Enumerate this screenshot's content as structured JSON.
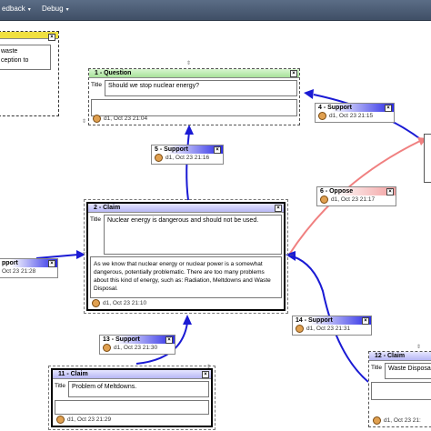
{
  "menu": {
    "feedback": "edback",
    "debug": "Debug"
  },
  "partial_top_left": {
    "lines": [
      "waste",
      "ception to"
    ]
  },
  "question": {
    "header": "1 - Question",
    "title_label": "Title",
    "title": "Should we stop nuclear energy?",
    "footer": "d1, Oct 23 21:04"
  },
  "claim2": {
    "header": "2 - Claim",
    "title_label": "Title",
    "title": "Nuclear energy is dangerous and should not be used.",
    "description": "As we know that nuclear energy or nuclear power is a somewhat dangerous, potentially problematic. There are too many problems about this kind of energy, such as: Radiation, Meltdowns and Waste Disposal.",
    "footer": "d1, Oct 23 21:10"
  },
  "claim11": {
    "header": "11 - Claim",
    "title_label": "Title",
    "title": "Problem of Meltdowns.",
    "footer": "d1, Oct 23 21:29"
  },
  "claim12": {
    "header": "12 - Claim",
    "title_label": "Title",
    "title": "Waste Disposa",
    "footer": "d1, Oct 23 21:"
  },
  "links": {
    "s5": {
      "label": "5 - Support",
      "footer": "d1, Oct 23 21:16"
    },
    "s4": {
      "label": "4 - Support",
      "footer": "d1, Oct 23 21:15"
    },
    "o6": {
      "label": "6 - Oppose",
      "footer": "d1, Oct 23 21:17"
    },
    "left": {
      "label": "pport",
      "footer": "Oct 23 21:28"
    },
    "s13": {
      "label": "13 - Support",
      "footer": "d1, Oct 23 21:30"
    },
    "s14": {
      "label": "14 - Support",
      "footer": "d1, Oct 23 21:31"
    }
  },
  "colors": {
    "support": "#1a1ad4",
    "oppose": "#f08080",
    "question_header": "#a8e29a",
    "claim_header": "#b7b7f4"
  }
}
